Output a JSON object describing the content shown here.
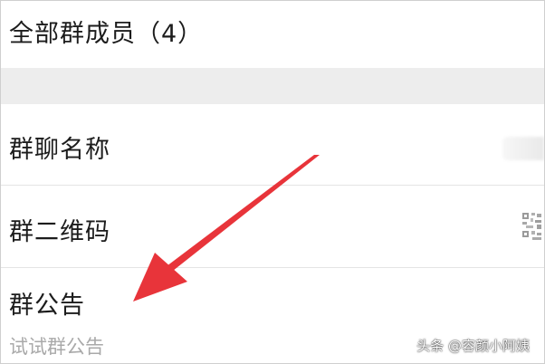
{
  "group_settings": {
    "members_row": {
      "label": "全部群成员（4）"
    },
    "group_name_row": {
      "label": "群聊名称"
    },
    "qr_code_row": {
      "label": "群二维码",
      "icon": "qr-code-icon"
    },
    "notice_row": {
      "label": "群公告",
      "preview": "试试群公告"
    }
  },
  "annotation": {
    "arrow_color": "#e8343a",
    "arrow_target": "notice_row"
  },
  "watermark": {
    "text": "头条 @容颜小阿姨"
  }
}
